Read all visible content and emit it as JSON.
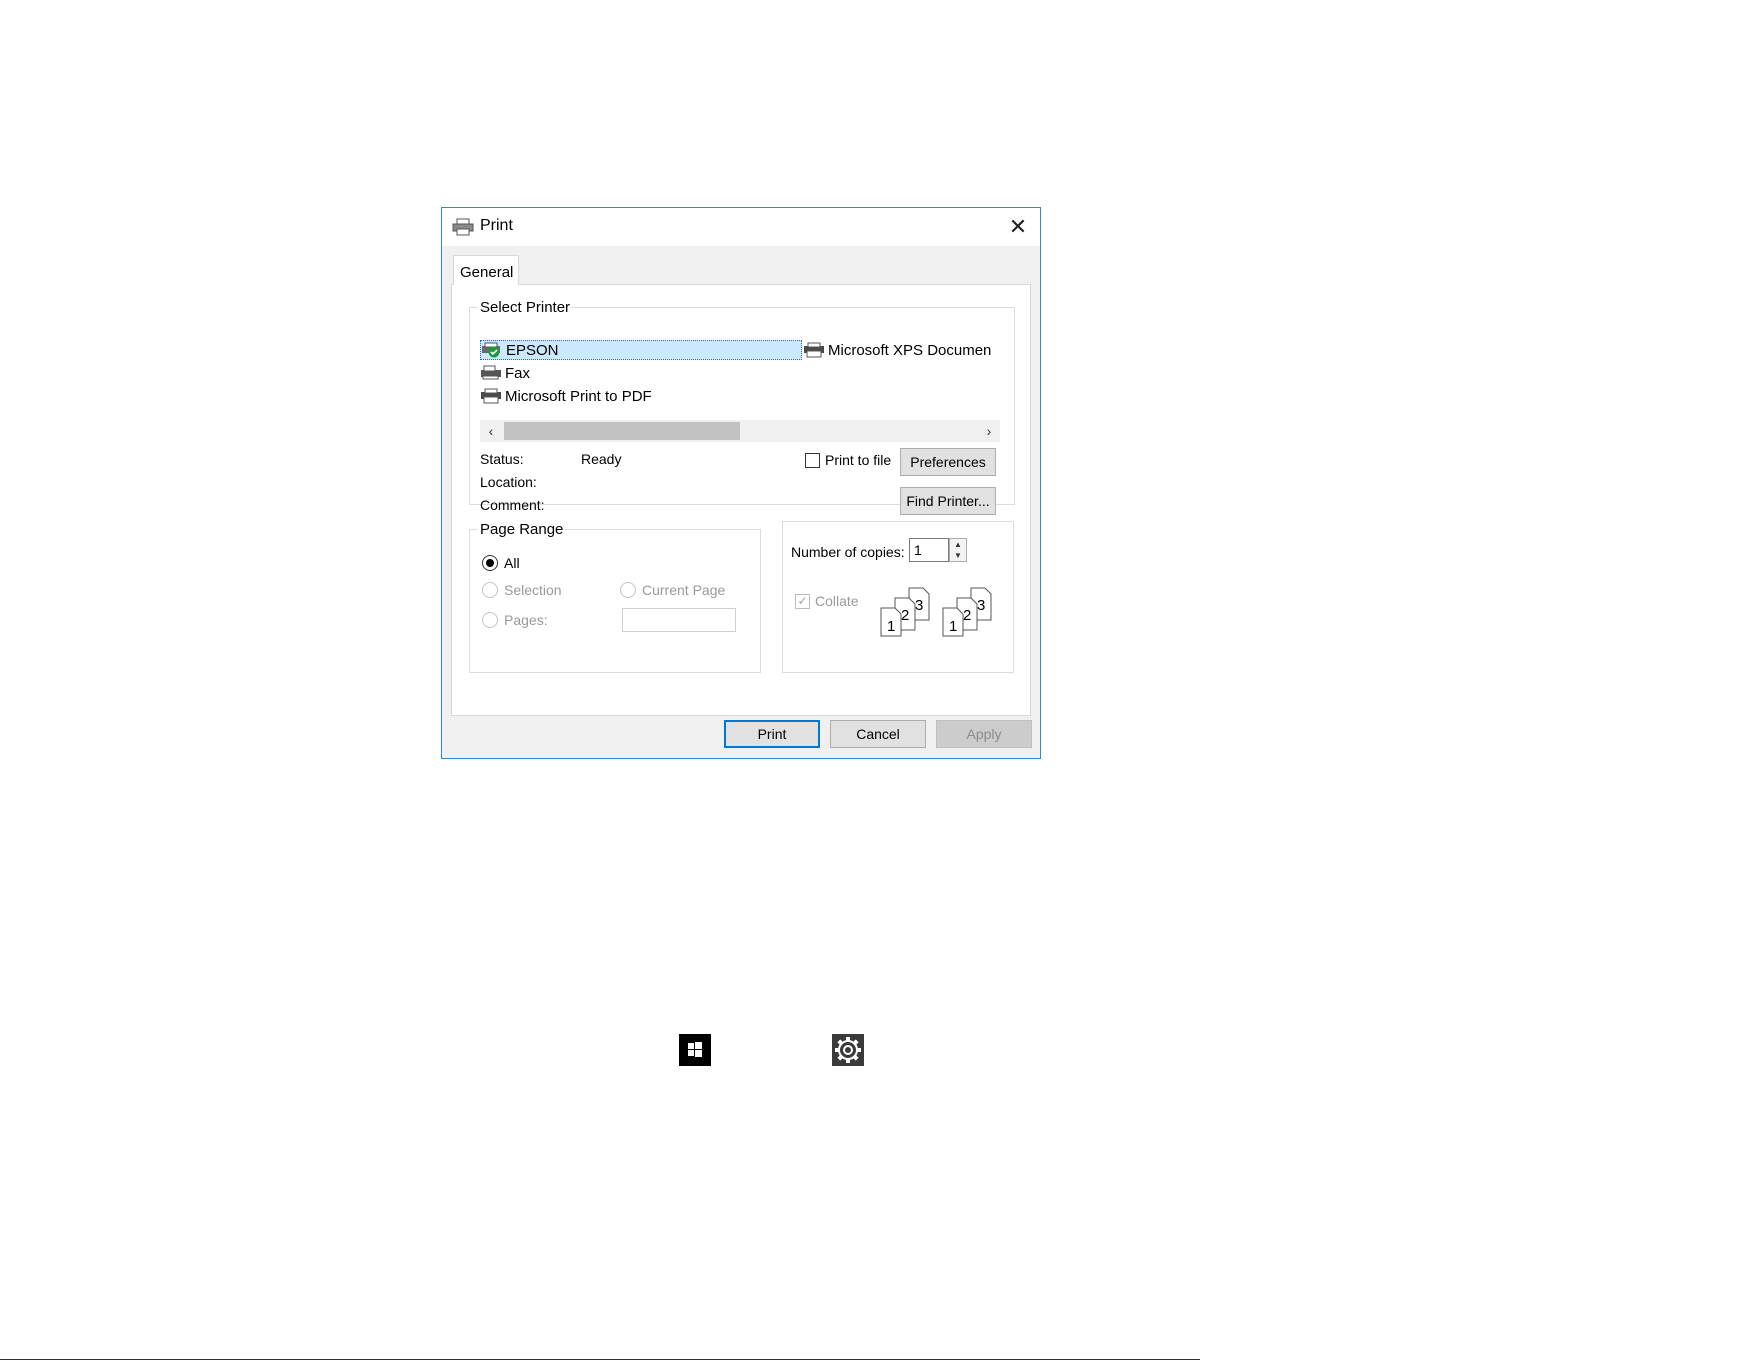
{
  "dialog": {
    "title": "Print",
    "close_glyph": "✕",
    "tab_label": "General",
    "select_printer": {
      "legend": "Select Printer",
      "printers": [
        {
          "name": "EPSON",
          "icon": "printer-default-icon",
          "selected": true
        },
        {
          "name": "Fax",
          "icon": "fax-icon",
          "selected": false
        },
        {
          "name": "Microsoft Print to PDF",
          "icon": "printer-icon",
          "selected": false
        },
        {
          "name": "Microsoft XPS Documen",
          "icon": "printer-icon",
          "selected": false
        }
      ],
      "scroll_left": "‹",
      "scroll_right": "›",
      "status_label": "Status:",
      "status_value": "Ready",
      "location_label": "Location:",
      "comment_label": "Comment:",
      "print_to_file_label": "Print to file",
      "print_to_file_checked": false,
      "preferences_label": "Preferences",
      "find_printer_label": "Find Printer..."
    },
    "page_range": {
      "legend": "Page Range",
      "all_label": "All",
      "selection_label": "Selection",
      "current_page_label": "Current Page",
      "pages_label": "Pages:",
      "pages_value": "",
      "selected": "All"
    },
    "copies": {
      "label": "Number of copies:",
      "value": "1",
      "collate_label": "Collate",
      "collate_checked": true,
      "collate_pages": [
        "1",
        "2",
        "3"
      ]
    },
    "buttons": {
      "print": "Print",
      "cancel": "Cancel",
      "apply": "Apply"
    }
  },
  "page_icons": [
    "windows-start-icon",
    "settings-gear-icon"
  ]
}
